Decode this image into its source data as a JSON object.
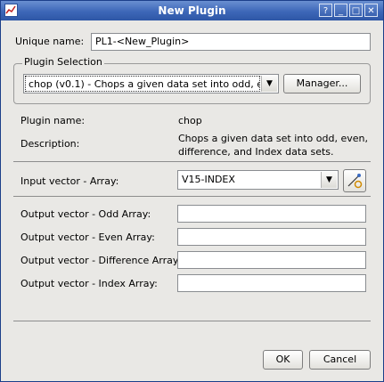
{
  "window": {
    "title": "New Plugin",
    "help_glyph": "?",
    "minimize_glyph": "_",
    "maximize_glyph": "□",
    "close_glyph": "✕"
  },
  "unique_name": {
    "label": "Unique name:",
    "value": "PL1-<New_Plugin>"
  },
  "plugin_selection": {
    "title": "Plugin Selection",
    "selected": "chop (v0.1) - Chops a given data set into odd, ev",
    "manager_label": "Manager..."
  },
  "info": {
    "name_label": "Plugin name:",
    "name_value": "chop",
    "description_label": "Description:",
    "description_line1": "Chops a given data set into odd, even,",
    "description_line2": "difference, and Index data sets."
  },
  "input_vector": {
    "label": "Input vector - Array:",
    "selected": "V15-INDEX"
  },
  "outputs": [
    {
      "label": "Output vector - Odd Array:",
      "value": ""
    },
    {
      "label": "Output vector - Even Array:",
      "value": ""
    },
    {
      "label": "Output vector - Difference Array:",
      "value": ""
    },
    {
      "label": "Output vector - Index Array:",
      "value": ""
    }
  ],
  "buttons": {
    "ok": "OK",
    "cancel": "Cancel"
  },
  "icons": {
    "app": "window-app-icon",
    "vector_select": "vector-select-icon"
  }
}
